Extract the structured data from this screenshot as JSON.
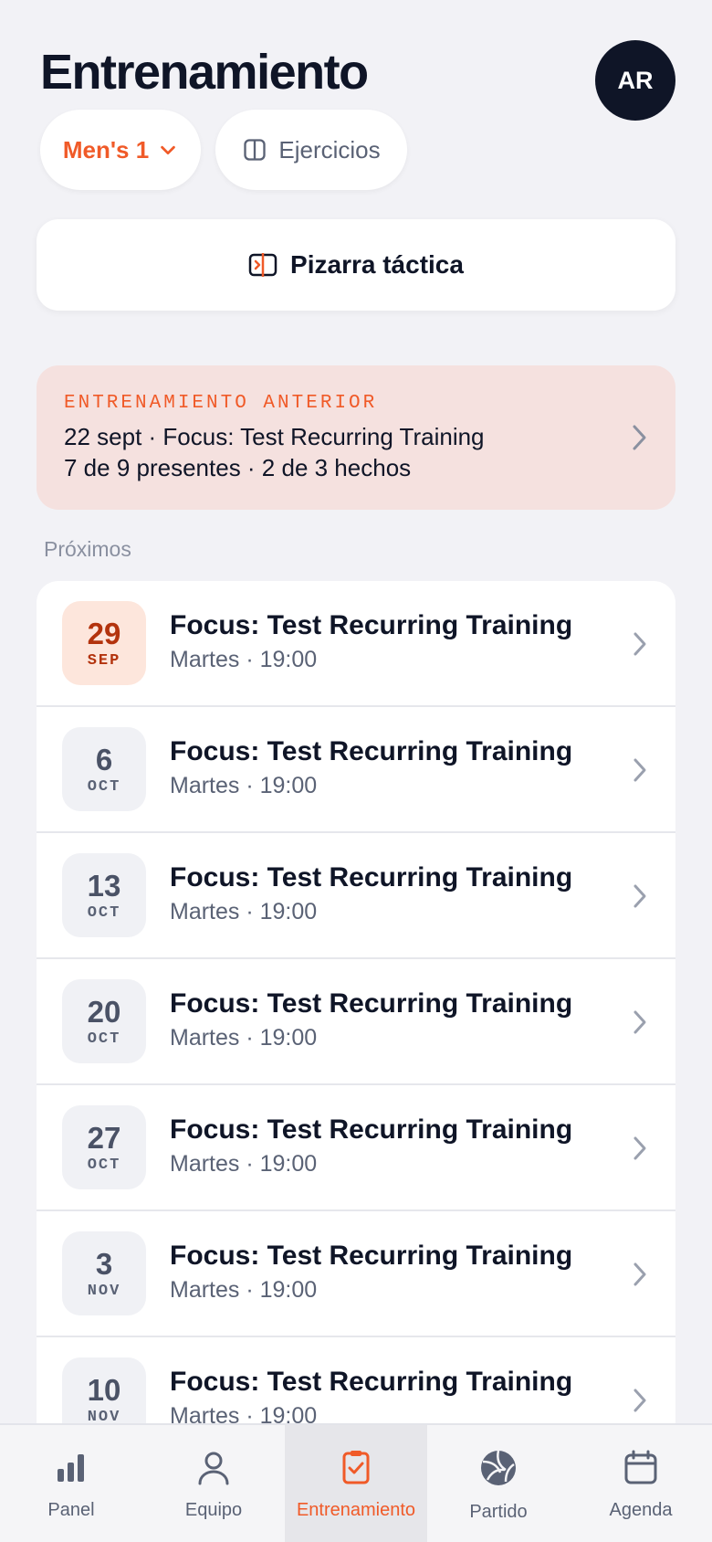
{
  "header": {
    "title": "Entrenamiento",
    "avatar_initials": "AR"
  },
  "filters": {
    "team_label": "Men's 1",
    "exercises_label": "Ejercicios"
  },
  "board_button_label": "Pizarra táctica",
  "previous": {
    "tag": "ENTRENAMIENTO ANTERIOR",
    "line1": "22 sept · Focus: Test Recurring Training",
    "line2": "7 de 9 presentes · 2 de 3 hechos"
  },
  "upcoming_label": "Próximos",
  "sessions": [
    {
      "day": "29",
      "month": "SEP",
      "title": "Focus: Test Recurring Training",
      "subtitle": "Martes · 19:00",
      "highlight": true
    },
    {
      "day": "6",
      "month": "OCT",
      "title": "Focus: Test Recurring Training",
      "subtitle": "Martes · 19:00",
      "highlight": false
    },
    {
      "day": "13",
      "month": "OCT",
      "title": "Focus: Test Recurring Training",
      "subtitle": "Martes · 19:00",
      "highlight": false
    },
    {
      "day": "20",
      "month": "OCT",
      "title": "Focus: Test Recurring Training",
      "subtitle": "Martes · 19:00",
      "highlight": false
    },
    {
      "day": "27",
      "month": "OCT",
      "title": "Focus: Test Recurring Training",
      "subtitle": "Martes · 19:00",
      "highlight": false
    },
    {
      "day": "3",
      "month": "NOV",
      "title": "Focus: Test Recurring Training",
      "subtitle": "Martes · 19:00",
      "highlight": false
    },
    {
      "day": "10",
      "month": "NOV",
      "title": "Focus: Test Recurring Training",
      "subtitle": "Martes · 19:00",
      "highlight": false
    }
  ],
  "tabs": [
    {
      "label": "Panel",
      "icon": "bar-chart-icon"
    },
    {
      "label": "Equipo",
      "icon": "user-icon"
    },
    {
      "label": "Entrenamiento",
      "icon": "clipboard-check-icon",
      "active": true
    },
    {
      "label": "Partido",
      "icon": "volleyball-icon"
    },
    {
      "label": "Agenda",
      "icon": "calendar-icon"
    }
  ],
  "colors": {
    "accent": "#f05a28",
    "dark": "#0f1527",
    "background": "#f2f2f6",
    "previous_card": "#f5e1df"
  }
}
